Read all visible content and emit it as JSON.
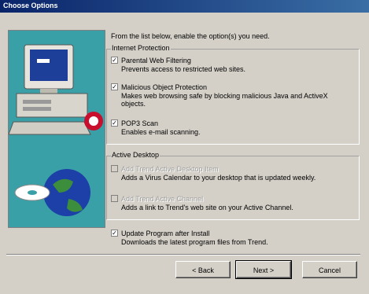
{
  "window": {
    "title": "Choose Options"
  },
  "intro": "From the list below, enable the option(s) you need.",
  "internet_protection": {
    "title": "Internet Protection",
    "options": [
      {
        "label": "Parental Web Filtering",
        "description": "Prevents access to restricted web sites.",
        "checked": true,
        "enabled": true
      },
      {
        "label": "Malicious Object Protection",
        "description": "Makes web browsing safe by blocking malicious Java and ActiveX objects.",
        "checked": true,
        "enabled": true
      },
      {
        "label": "POP3 Scan",
        "description": "Enables e-mail scanning.",
        "checked": true,
        "enabled": true
      }
    ]
  },
  "active_desktop": {
    "title": "Active Desktop",
    "options": [
      {
        "label": "Add Trend Active Desktop Item",
        "description": "Adds a Virus Calendar to your desktop that is updated weekly.",
        "checked": false,
        "enabled": false
      },
      {
        "label": "Add Trend Active Channel",
        "description": "Adds a link to Trend's web site on your Active Channel.",
        "checked": false,
        "enabled": false
      }
    ]
  },
  "update": {
    "label": "Update Program after Install",
    "description": "Downloads the latest program files from Trend.",
    "checked": true,
    "enabled": true
  },
  "buttons": {
    "back": "< Back",
    "next": "Next >",
    "cancel": "Cancel"
  },
  "icons": {
    "art": "computer-and-globe-illustration",
    "check": "checkmark-icon"
  }
}
